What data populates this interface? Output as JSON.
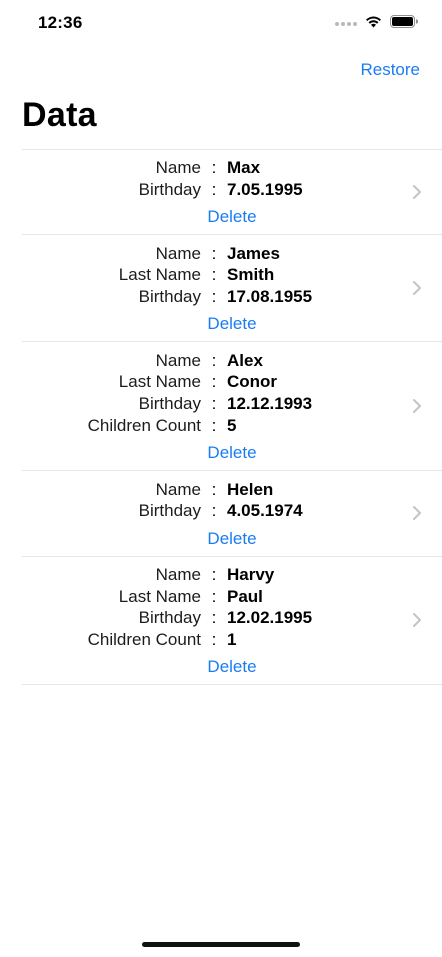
{
  "status_bar": {
    "time": "12:36",
    "icons": [
      "signal-icon",
      "wifi-icon",
      "battery-icon"
    ]
  },
  "nav": {
    "restore_label": "Restore",
    "title": "Data"
  },
  "colors": {
    "accent": "#1a7cf5",
    "separator": "#e5e5ea",
    "chevron": "#c4c4c7"
  },
  "rows": [
    {
      "fields": [
        {
          "label": "Name",
          "value": "Max"
        },
        {
          "label": "Birthday",
          "value": "7.05.1995"
        }
      ],
      "delete_label": "Delete"
    },
    {
      "fields": [
        {
          "label": "Name",
          "value": "James"
        },
        {
          "label": "Last Name",
          "value": "Smith"
        },
        {
          "label": "Birthday",
          "value": "17.08.1955"
        }
      ],
      "delete_label": "Delete"
    },
    {
      "fields": [
        {
          "label": "Name",
          "value": "Alex"
        },
        {
          "label": "Last Name",
          "value": "Conor"
        },
        {
          "label": "Birthday",
          "value": "12.12.1993"
        },
        {
          "label": "Children Count",
          "value": "5"
        }
      ],
      "delete_label": "Delete"
    },
    {
      "fields": [
        {
          "label": "Name",
          "value": "Helen"
        },
        {
          "label": "Birthday",
          "value": "4.05.1974"
        }
      ],
      "delete_label": "Delete"
    },
    {
      "fields": [
        {
          "label": "Name",
          "value": "Harvy"
        },
        {
          "label": "Last Name",
          "value": "Paul"
        },
        {
          "label": "Birthday",
          "value": "12.02.1995"
        },
        {
          "label": "Children Count",
          "value": "1"
        }
      ],
      "delete_label": "Delete"
    }
  ]
}
